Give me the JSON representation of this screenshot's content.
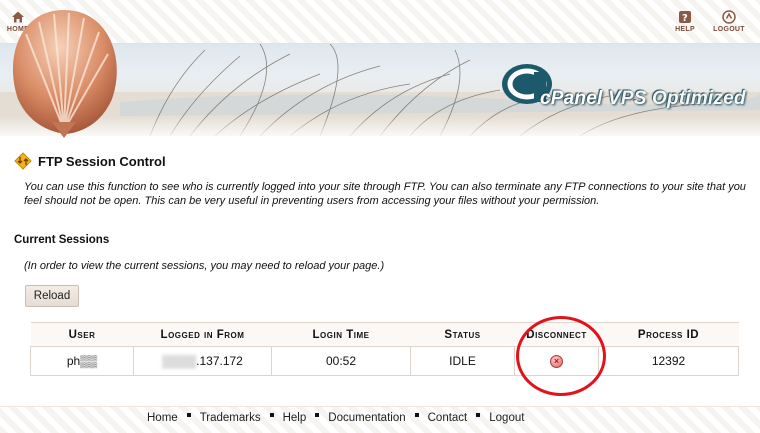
{
  "topbar": {
    "home_label": "HOME",
    "help_label": "HELP",
    "logout_label": "LOGOUT"
  },
  "banner": {
    "brand": "cPanel",
    "tagline": "VPS Optimized"
  },
  "page": {
    "title": "FTP Session Control",
    "description": "You can use this function to see who is currently logged into your site through FTP. You can also terminate any FTP connections to your site that you feel should not be open. This can be very useful in preventing users from accessing your files without your permission.",
    "section_heading": "Current Sessions",
    "note": "(In order to view the current sessions, you may need to reload your page.)",
    "reload_label": "Reload"
  },
  "table": {
    "headers": [
      "User",
      "Logged in From",
      "Login Time",
      "Status",
      "Disconnect",
      "Process ID"
    ],
    "rows": [
      {
        "user": "ph▒▒",
        "from_masked": "▒▒▒▒",
        "from": ".137.172",
        "login_time": "00:52",
        "status": "IDLE",
        "disconnect_icon": "x-circle-icon",
        "process_id": "12392"
      }
    ]
  },
  "footer": {
    "links": [
      "Home",
      "Trademarks",
      "Help",
      "Documentation",
      "Contact",
      "Logout"
    ]
  },
  "colors": {
    "accent": "#7a4a3a",
    "annotation": "#e3121a",
    "header_bg": "#fbf8f5"
  }
}
